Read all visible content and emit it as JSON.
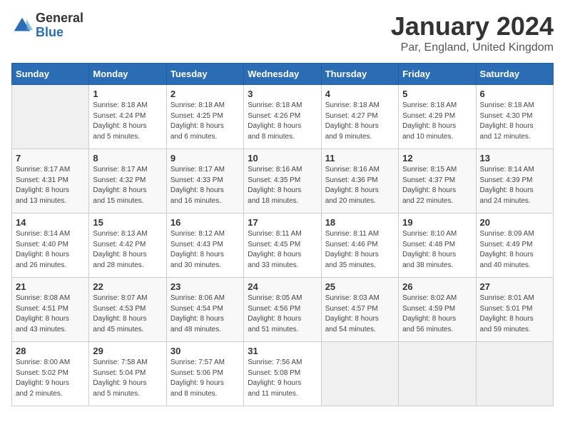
{
  "logo": {
    "general": "General",
    "blue": "Blue"
  },
  "title": "January 2024",
  "subtitle": "Par, England, United Kingdom",
  "days_of_week": [
    "Sunday",
    "Monday",
    "Tuesday",
    "Wednesday",
    "Thursday",
    "Friday",
    "Saturday"
  ],
  "weeks": [
    [
      {
        "day": "",
        "info": ""
      },
      {
        "day": "1",
        "info": "Sunrise: 8:18 AM\nSunset: 4:24 PM\nDaylight: 8 hours\nand 5 minutes."
      },
      {
        "day": "2",
        "info": "Sunrise: 8:18 AM\nSunset: 4:25 PM\nDaylight: 8 hours\nand 6 minutes."
      },
      {
        "day": "3",
        "info": "Sunrise: 8:18 AM\nSunset: 4:26 PM\nDaylight: 8 hours\nand 8 minutes."
      },
      {
        "day": "4",
        "info": "Sunrise: 8:18 AM\nSunset: 4:27 PM\nDaylight: 8 hours\nand 9 minutes."
      },
      {
        "day": "5",
        "info": "Sunrise: 8:18 AM\nSunset: 4:29 PM\nDaylight: 8 hours\nand 10 minutes."
      },
      {
        "day": "6",
        "info": "Sunrise: 8:18 AM\nSunset: 4:30 PM\nDaylight: 8 hours\nand 12 minutes."
      }
    ],
    [
      {
        "day": "7",
        "info": "Sunrise: 8:17 AM\nSunset: 4:31 PM\nDaylight: 8 hours\nand 13 minutes."
      },
      {
        "day": "8",
        "info": "Sunrise: 8:17 AM\nSunset: 4:32 PM\nDaylight: 8 hours\nand 15 minutes."
      },
      {
        "day": "9",
        "info": "Sunrise: 8:17 AM\nSunset: 4:33 PM\nDaylight: 8 hours\nand 16 minutes."
      },
      {
        "day": "10",
        "info": "Sunrise: 8:16 AM\nSunset: 4:35 PM\nDaylight: 8 hours\nand 18 minutes."
      },
      {
        "day": "11",
        "info": "Sunrise: 8:16 AM\nSunset: 4:36 PM\nDaylight: 8 hours\nand 20 minutes."
      },
      {
        "day": "12",
        "info": "Sunrise: 8:15 AM\nSunset: 4:37 PM\nDaylight: 8 hours\nand 22 minutes."
      },
      {
        "day": "13",
        "info": "Sunrise: 8:14 AM\nSunset: 4:39 PM\nDaylight: 8 hours\nand 24 minutes."
      }
    ],
    [
      {
        "day": "14",
        "info": "Sunrise: 8:14 AM\nSunset: 4:40 PM\nDaylight: 8 hours\nand 26 minutes."
      },
      {
        "day": "15",
        "info": "Sunrise: 8:13 AM\nSunset: 4:42 PM\nDaylight: 8 hours\nand 28 minutes."
      },
      {
        "day": "16",
        "info": "Sunrise: 8:12 AM\nSunset: 4:43 PM\nDaylight: 8 hours\nand 30 minutes."
      },
      {
        "day": "17",
        "info": "Sunrise: 8:11 AM\nSunset: 4:45 PM\nDaylight: 8 hours\nand 33 minutes."
      },
      {
        "day": "18",
        "info": "Sunrise: 8:11 AM\nSunset: 4:46 PM\nDaylight: 8 hours\nand 35 minutes."
      },
      {
        "day": "19",
        "info": "Sunrise: 8:10 AM\nSunset: 4:48 PM\nDaylight: 8 hours\nand 38 minutes."
      },
      {
        "day": "20",
        "info": "Sunrise: 8:09 AM\nSunset: 4:49 PM\nDaylight: 8 hours\nand 40 minutes."
      }
    ],
    [
      {
        "day": "21",
        "info": "Sunrise: 8:08 AM\nSunset: 4:51 PM\nDaylight: 8 hours\nand 43 minutes."
      },
      {
        "day": "22",
        "info": "Sunrise: 8:07 AM\nSunset: 4:53 PM\nDaylight: 8 hours\nand 45 minutes."
      },
      {
        "day": "23",
        "info": "Sunrise: 8:06 AM\nSunset: 4:54 PM\nDaylight: 8 hours\nand 48 minutes."
      },
      {
        "day": "24",
        "info": "Sunrise: 8:05 AM\nSunset: 4:56 PM\nDaylight: 8 hours\nand 51 minutes."
      },
      {
        "day": "25",
        "info": "Sunrise: 8:03 AM\nSunset: 4:57 PM\nDaylight: 8 hours\nand 54 minutes."
      },
      {
        "day": "26",
        "info": "Sunrise: 8:02 AM\nSunset: 4:59 PM\nDaylight: 8 hours\nand 56 minutes."
      },
      {
        "day": "27",
        "info": "Sunrise: 8:01 AM\nSunset: 5:01 PM\nDaylight: 8 hours\nand 59 minutes."
      }
    ],
    [
      {
        "day": "28",
        "info": "Sunrise: 8:00 AM\nSunset: 5:02 PM\nDaylight: 9 hours\nand 2 minutes."
      },
      {
        "day": "29",
        "info": "Sunrise: 7:58 AM\nSunset: 5:04 PM\nDaylight: 9 hours\nand 5 minutes."
      },
      {
        "day": "30",
        "info": "Sunrise: 7:57 AM\nSunset: 5:06 PM\nDaylight: 9 hours\nand 8 minutes."
      },
      {
        "day": "31",
        "info": "Sunrise: 7:56 AM\nSunset: 5:08 PM\nDaylight: 9 hours\nand 11 minutes."
      },
      {
        "day": "",
        "info": ""
      },
      {
        "day": "",
        "info": ""
      },
      {
        "day": "",
        "info": ""
      }
    ]
  ]
}
